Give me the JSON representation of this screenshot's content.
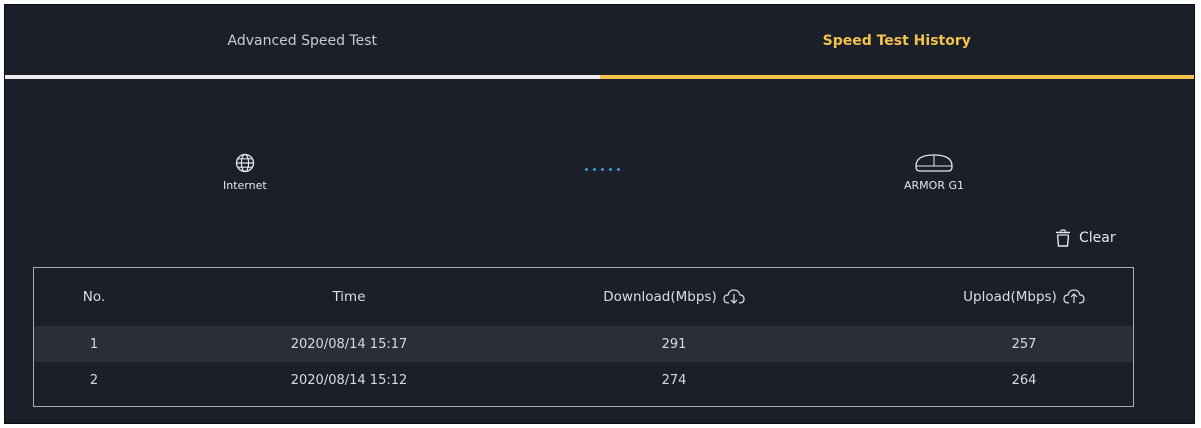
{
  "tabs": [
    {
      "label": "Advanced Speed Test",
      "active": false
    },
    {
      "label": "Speed Test History",
      "active": true
    }
  ],
  "topology": {
    "internet_label": "Internet",
    "router_label": "ARMOR G1",
    "internet_icon": "globe-icon",
    "router_icon": "router-icon"
  },
  "actions": {
    "clear_label": "Clear",
    "clear_icon": "trash-icon"
  },
  "history_table": {
    "columns": [
      "No.",
      "Time",
      "Download(Mbps)",
      "Upload(Mbps)"
    ],
    "rows": [
      {
        "no": "1",
        "time": "2020/08/14 15:17",
        "download": "291",
        "upload": "257"
      },
      {
        "no": "2",
        "time": "2020/08/14 15:12",
        "download": "274",
        "upload": "264"
      }
    ]
  },
  "colors": {
    "background": "#1b1f2a",
    "accent": "#f1c34a",
    "row_highlight": "#2a2e38",
    "link_dots": "#3a9bd8"
  }
}
